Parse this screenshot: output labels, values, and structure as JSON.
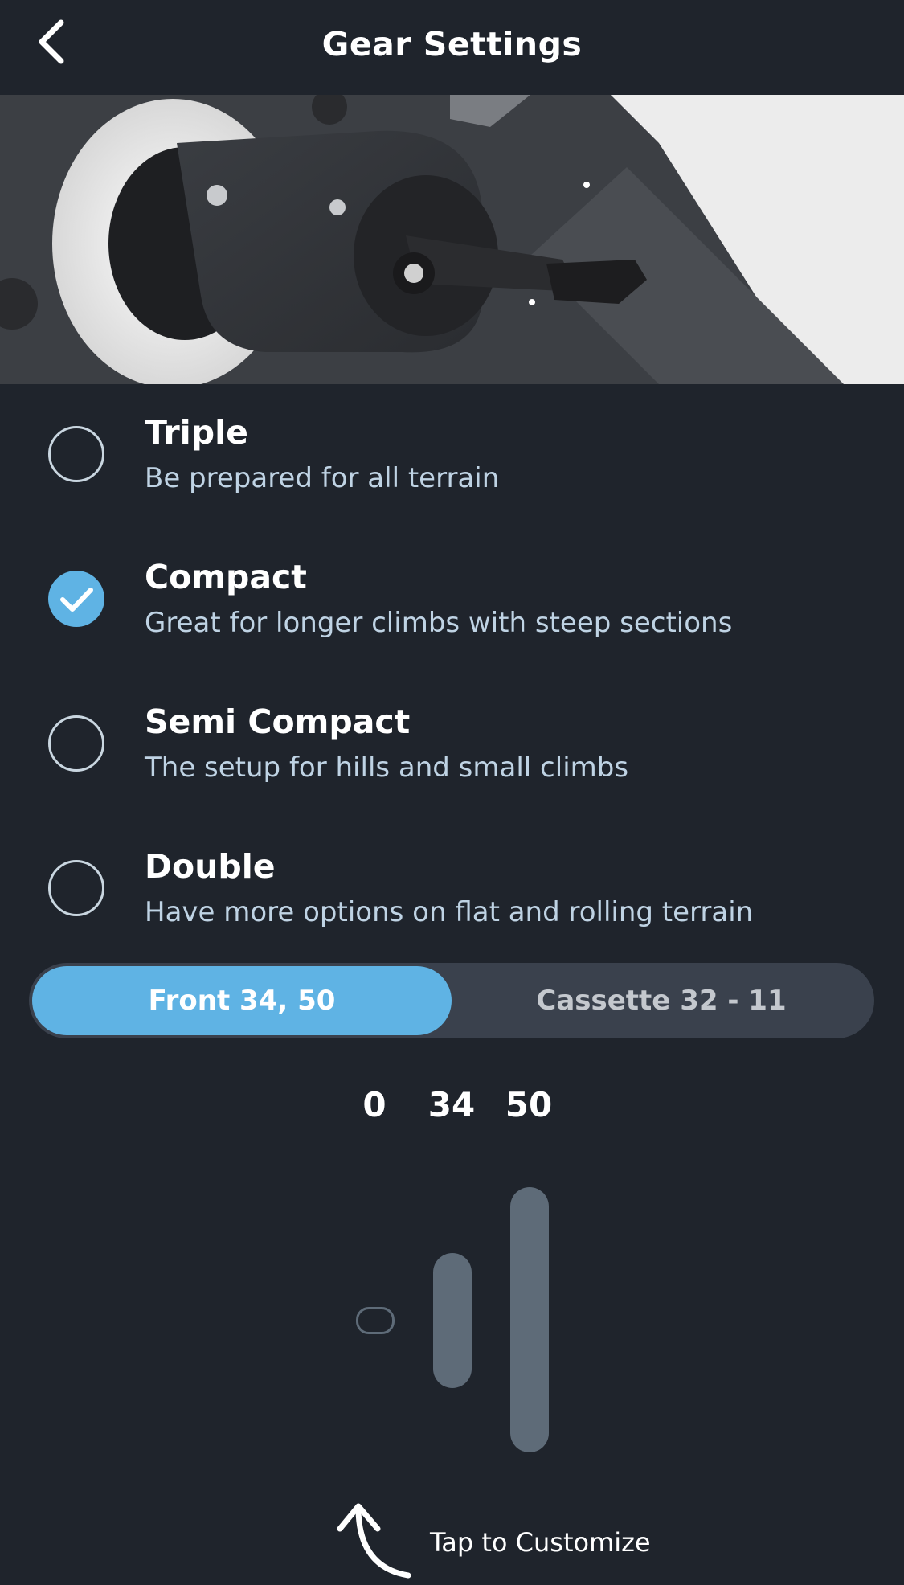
{
  "header": {
    "title": "Gear Settings",
    "back_icon": "chevron-left-icon"
  },
  "options": [
    {
      "title": "Triple",
      "description": "Be prepared for all terrain",
      "selected": false
    },
    {
      "title": "Compact",
      "description": "Great for longer climbs with steep sections",
      "selected": true
    },
    {
      "title": "Semi Compact",
      "description": "The setup for hills and small climbs",
      "selected": false
    },
    {
      "title": "Double",
      "description": "Have more options on flat and rolling terrain",
      "selected": false
    }
  ],
  "segment": {
    "front_label": "Front 34, 50",
    "cassette_label": "Cassette 32 - 11",
    "active": "front"
  },
  "chainrings": {
    "labels": [
      "0",
      "34",
      "50"
    ],
    "values": [
      0,
      34,
      50
    ]
  },
  "customize": {
    "label": "Tap to Customize",
    "icon": "curved-arrow-up-icon"
  },
  "colors": {
    "background": "#1f242c",
    "accent": "#5fb3e4",
    "segment_bg": "#3a414d",
    "bar": "#5e6b78",
    "subtitle": "#bfd3e4"
  }
}
